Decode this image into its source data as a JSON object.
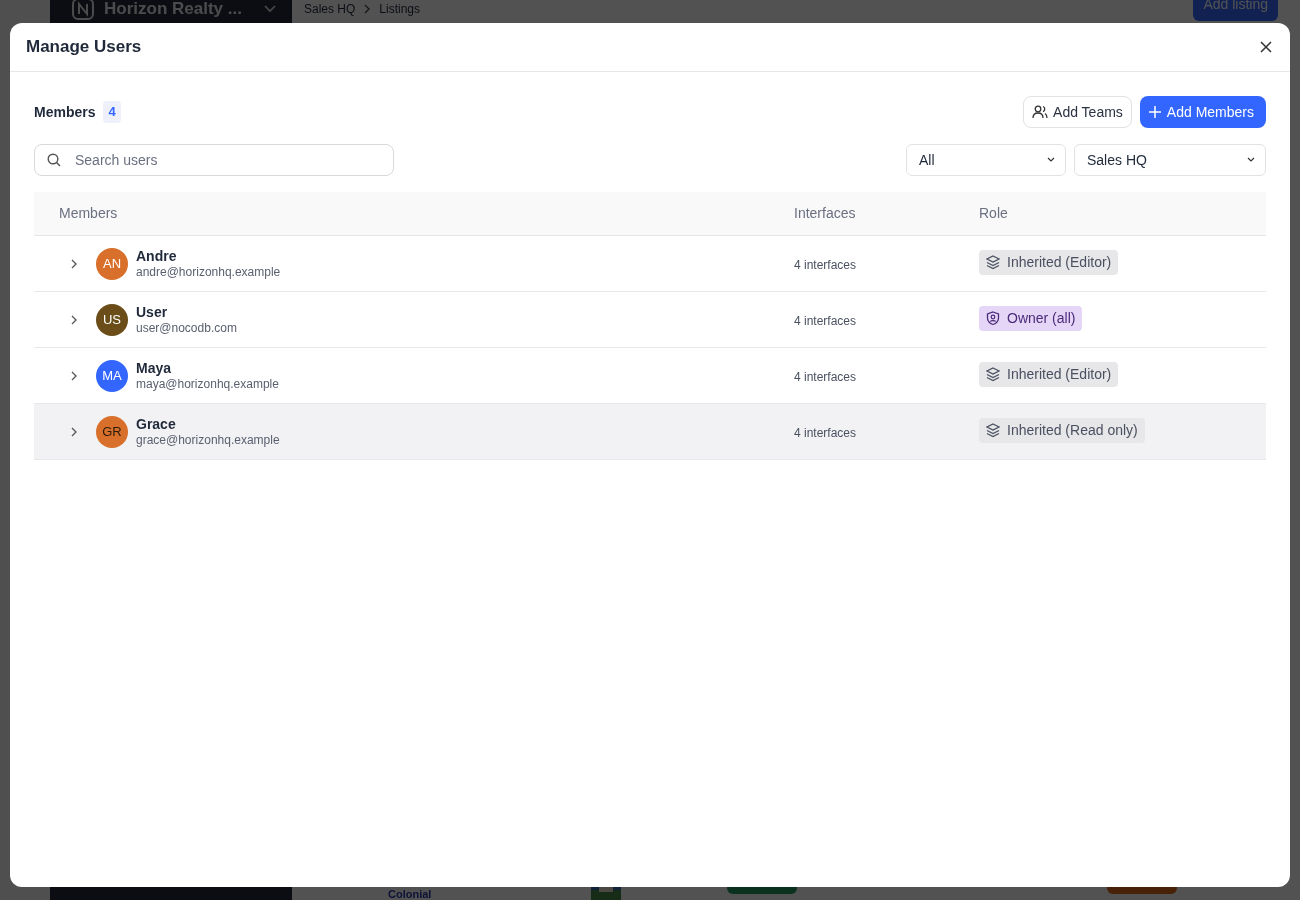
{
  "background": {
    "workspace": "Horizon Realty ...",
    "breadcrumb": [
      "Sales HQ",
      "Listings"
    ],
    "action_button": "Add listing",
    "row_title": "Colonial"
  },
  "modal": {
    "title": "Manage Users",
    "members_label": "Members",
    "members_count": "4",
    "buttons": [
      {
        "label": "Add Teams",
        "kind": "secondary"
      },
      {
        "label": "Add Members",
        "kind": "primary"
      }
    ],
    "search": {
      "placeholder": "Search users"
    },
    "filters": [
      {
        "value": "All"
      },
      {
        "value": "Sales HQ"
      }
    ],
    "table": {
      "columns": [
        "Members",
        "Interfaces",
        "Role"
      ],
      "rows": [
        {
          "initials": "AN",
          "color": "#d86f2b",
          "dark_text": false,
          "name": "Andre",
          "email": "andre@horizonhq.example",
          "interfaces": "4 interfaces",
          "role": {
            "label": "Inherited (Editor)",
            "kind": "inherited"
          },
          "hovered": false
        },
        {
          "initials": "US",
          "color": "#6b4d1a",
          "dark_text": false,
          "name": "User",
          "email": "user@nocodb.com",
          "interfaces": "4 interfaces",
          "role": {
            "label": "Owner (all)",
            "kind": "owner"
          },
          "hovered": false
        },
        {
          "initials": "MA",
          "color": "#3366ff",
          "dark_text": false,
          "name": "Maya",
          "email": "maya@horizonhq.example",
          "interfaces": "4 interfaces",
          "role": {
            "label": "Inherited (Editor)",
            "kind": "inherited"
          },
          "hovered": false
        },
        {
          "initials": "GR",
          "color": "#d8702c",
          "dark_text": true,
          "name": "Grace",
          "email": "grace@horizonhq.example",
          "interfaces": "4 interfaces",
          "role": {
            "label": "Inherited (Read only)",
            "kind": "inherited"
          },
          "hovered": true
        }
      ]
    }
  }
}
